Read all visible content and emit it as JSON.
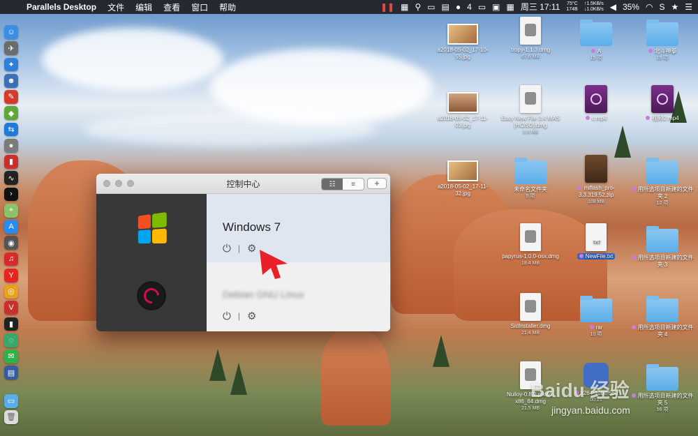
{
  "menubar": {
    "app_name": "Parallels Desktop",
    "menus": [
      "文件",
      "编辑",
      "查看",
      "窗口",
      "帮助"
    ],
    "tray_notification_count": "4",
    "network_up": "↑1.5KB/s",
    "network_down": "↓1.0KB/s",
    "temp": "75°C",
    "mem": "174B",
    "clock": "周三 17:11",
    "battery": "35%"
  },
  "dock": {
    "items": [
      "finder",
      "launchpad",
      "safari",
      "contacts",
      "note",
      "android-studio",
      "teamviewer",
      "disk-utility",
      "istat",
      "activity-monitor",
      "terminal",
      "maps",
      "app-store",
      "safari-alt",
      "netease-music",
      "yandex",
      "chrome",
      "vivaldi",
      "terminal-alt",
      "fx",
      "wechat",
      "desktop-stack",
      "downloads",
      "trash"
    ]
  },
  "window": {
    "title": "控制中心",
    "vms": [
      {
        "name": "Windows 7",
        "os": "windows"
      },
      {
        "name": "Debian GNU Linux",
        "os": "debian"
      }
    ]
  },
  "desktop": {
    "items": [
      {
        "name": "a2018-05-02_17-10-55.jpg",
        "size": "",
        "type": "image"
      },
      {
        "name": "tropy-1.1.3.dmg",
        "size": "67.6 MB",
        "type": "dmg"
      },
      {
        "name": "A",
        "size": "15 项",
        "type": "folder"
      },
      {
        "name": "北斗神拳",
        "size": "15 项",
        "type": "folder"
      },
      {
        "name": "a2018-05-02_17-11-03.jpg",
        "size": "",
        "type": "image"
      },
      {
        "name": "Easy New File 3.4 MAS [HCiSO].dmg",
        "size": "9.6 MB",
        "type": "dmg"
      },
      {
        "name": "c.mp4",
        "size": "",
        "type": "video"
      },
      {
        "name": "视频2.mp4",
        "size": "",
        "type": "video"
      },
      {
        "name": "a2018-05-02_17-11-32.jpg",
        "size": "",
        "type": "image"
      },
      {
        "name": "未命名文件夹",
        "size": "5 项",
        "type": "folder"
      },
      {
        "name": "miflash_pro-3.3.319.52.zip",
        "size": "108 MB",
        "type": "zip"
      },
      {
        "name": "用所选项目新建的文件夹 2",
        "size": "12 项",
        "type": "folder"
      },
      {
        "name": "papyrus-1.0.0-osx.dmg",
        "size": "18.4 MB",
        "type": "dmg"
      },
      {
        "name": "NewFile.txt",
        "size": "",
        "type": "txt"
      },
      {
        "name": "用所选项目新建的文件夹 3",
        "size": "",
        "type": "folder"
      },
      {
        "name": "SidInstaller.dmg",
        "size": "21.4 MB",
        "type": "dmg"
      },
      {
        "name": "rar",
        "size": "10 项",
        "type": "folder"
      },
      {
        "name": "用所选项目新建的文件夹 4",
        "size": "",
        "type": "folder"
      },
      {
        "name": "Nuiloy-0.8.2.pre46-x86_64.dmg",
        "size": "21.5 MB",
        "type": "dmg"
      },
      {
        "name": "x264-10bit-560",
        "size": "00:21",
        "type": "paw"
      },
      {
        "name": "用所选项目新建的文件夹 5",
        "size": "56 项",
        "type": "folder"
      }
    ]
  },
  "watermark": {
    "text": "Baidu 经验",
    "url": "jingyan.baidu.com"
  }
}
